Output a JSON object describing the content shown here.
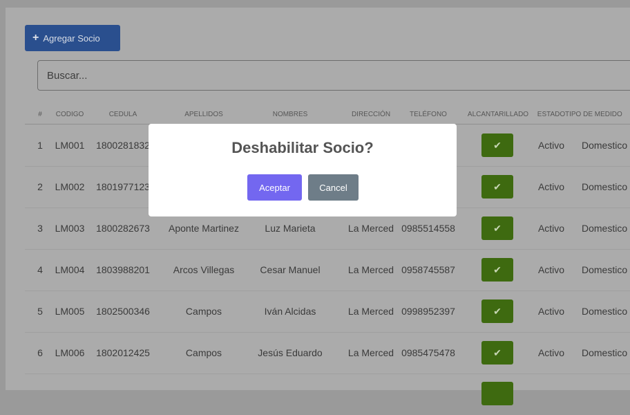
{
  "toolbar": {
    "add_label": "Agregar Socio"
  },
  "search": {
    "placeholder": "Buscar..."
  },
  "table": {
    "headers": [
      "#",
      "CODIGO",
      "CEDULA",
      "APELLIDOS",
      "NOMBRES",
      "DIRECCIÓN",
      "TELÉFONO",
      "ALCANTARILLADO",
      "ESTADO",
      "TIPO DE MEDIDO"
    ],
    "check_glyph": "✔",
    "rows": [
      {
        "num": "1",
        "codigo": "LM001",
        "cedula": "1800281832",
        "apellidos": "",
        "nombres": "",
        "direccion": "",
        "telefono": "",
        "estado": "Activo",
        "tipo": "Domestico"
      },
      {
        "num": "2",
        "codigo": "LM002",
        "cedula": "1801977123",
        "apellidos": "",
        "nombres": "",
        "direccion": "",
        "telefono": "",
        "estado": "Activo",
        "tipo": "Domestico"
      },
      {
        "num": "3",
        "codigo": "LM003",
        "cedula": "1800282673",
        "apellidos": "Aponte Martinez",
        "nombres": "Luz Marieta",
        "direccion": "La Merced",
        "telefono": "0985514558",
        "estado": "Activo",
        "tipo": "Domestico"
      },
      {
        "num": "4",
        "codigo": "LM004",
        "cedula": "1803988201",
        "apellidos": "Arcos Villegas",
        "nombres": "Cesar Manuel",
        "direccion": "La Merced",
        "telefono": "0958745587",
        "estado": "Activo",
        "tipo": "Domestico"
      },
      {
        "num": "5",
        "codigo": "LM005",
        "cedula": "1802500346",
        "apellidos": "Campos",
        "nombres": "Iván Alcidas",
        "direccion": "La Merced",
        "telefono": "0998952397",
        "estado": "Activo",
        "tipo": "Domestico"
      },
      {
        "num": "6",
        "codigo": "LM006",
        "cedula": "1802012425",
        "apellidos": "Campos",
        "nombres": "Jesús Eduardo",
        "direccion": "La Merced",
        "telefono": "0985475478",
        "estado": "Activo",
        "tipo": "Domestico"
      },
      {
        "num": "",
        "codigo": "",
        "cedula": "",
        "apellidos": "",
        "nombres": "",
        "direccion": "",
        "telefono": "",
        "estado": "",
        "tipo": ""
      }
    ]
  },
  "modal": {
    "title": "Deshabilitar Socio?",
    "confirm_label": "Aceptar",
    "cancel_label": "Cancel"
  },
  "colors": {
    "add_button": "#2a4f8e",
    "check_button": "#3e6a10",
    "confirm_button": "#7367f0",
    "cancel_button": "#6e7d88"
  },
  "icons": {
    "add": "plus-icon",
    "check": "check-icon"
  }
}
